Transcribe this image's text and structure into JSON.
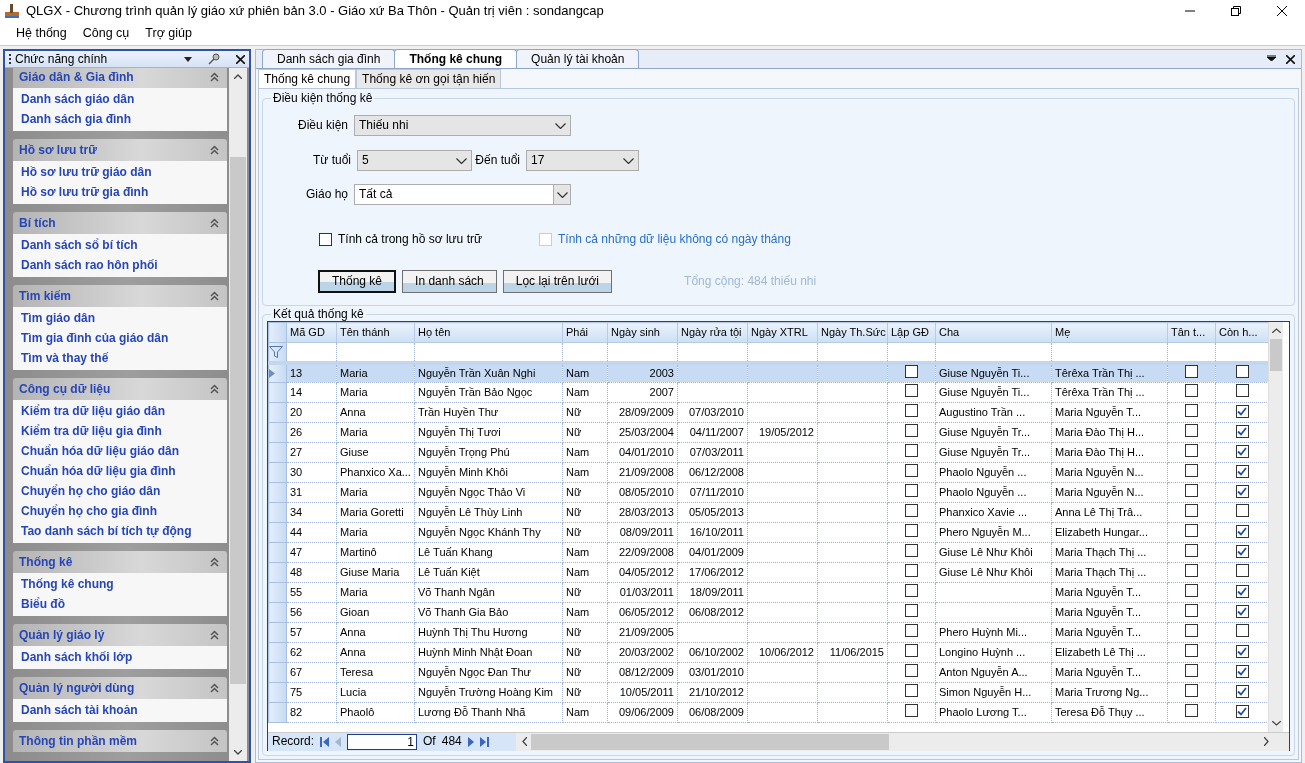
{
  "window": {
    "title": "QLGX - Chương trình quản lý giáo xứ phiên bản 3.0 - Giáo xứ Ba Thôn - Quản trị viên : sondangcap"
  },
  "menu": [
    "Hệ thống",
    "Công cụ",
    "Trợ giúp"
  ],
  "sidebar": {
    "title": "Chức năng chính",
    "groups": [
      {
        "title": "Giáo dân & Gia đình",
        "items": [
          "Danh sách giáo dân",
          "Danh sách gia đình"
        ]
      },
      {
        "title": "Hồ sơ lưu trữ",
        "items": [
          "Hồ sơ lưu trữ giáo dân",
          "Hồ sơ lưu trữ gia đình"
        ]
      },
      {
        "title": "Bí tích",
        "items": [
          "Danh sách sổ bí tích",
          "Danh sách rao hôn phối"
        ]
      },
      {
        "title": "Tìm kiếm",
        "items": [
          "Tìm giáo dân",
          "Tìm gia đình của giáo dân",
          "Tìm và thay thế"
        ]
      },
      {
        "title": "Công cụ dữ liệu",
        "items": [
          "Kiểm tra dữ liệu giáo dân",
          "Kiểm tra dữ liệu gia đình",
          "Chuẩn hóa dữ liệu giáo dân",
          "Chuẩn hóa dữ liệu gia đình",
          "Chuyển họ cho giáo dân",
          "Chuyển họ cho gia đình",
          "Tao danh sách bí tích tự động"
        ]
      },
      {
        "title": "Thống kê",
        "items": [
          "Thống kê chung",
          "Biểu đồ"
        ]
      },
      {
        "title": "Quản lý giáo lý",
        "items": [
          "Danh sách khối lớp"
        ]
      },
      {
        "title": "Quản lý người dùng",
        "items": [
          "Danh sách tài khoản"
        ]
      },
      {
        "title": "Thông tin phần mềm"
      }
    ]
  },
  "document_tabs": [
    {
      "label": "Danh sách gia đình",
      "selected": false
    },
    {
      "label": "Thống kê chung",
      "selected": true
    },
    {
      "label": "Quản lý tài khoản",
      "selected": false
    }
  ],
  "sub_tabs": [
    {
      "label": "Thống kê chung",
      "selected": true
    },
    {
      "label": "Thống kê ơn gọi tận hiến",
      "selected": false
    }
  ],
  "conditions": {
    "legend": "Điều kiện thống kê",
    "condition": {
      "label": "Điều kiện",
      "value": "Thiếu nhi"
    },
    "from_age": {
      "label": "Từ tuổi",
      "value": "5"
    },
    "to_age": {
      "label": "Đến tuổi",
      "value": "17"
    },
    "parish": {
      "label": "Giáo họ",
      "value": "Tất cả"
    },
    "checkboxes": [
      {
        "label": "Tính cả trong hồ sơ lưu trữ",
        "checked": false,
        "disabled": false
      },
      {
        "label": "Tính cả những dữ liệu không có ngày tháng",
        "checked": false,
        "disabled": true
      }
    ],
    "buttons": [
      {
        "label": "Thống kê",
        "default": true
      },
      {
        "label": "In danh sách",
        "default": false
      },
      {
        "label": "Lọc lại trên lưới",
        "default": false
      }
    ],
    "total": "Tổng cộng: 484 thiếu nhi"
  },
  "results": {
    "legend": "Kết quả thống kê",
    "columns": [
      "Mã GD",
      "Tên thánh",
      "Họ tên",
      "Phái",
      "Ngày sinh",
      "Ngày rửa tội",
      "Ngày XTRL",
      "Ngày Th.Sức",
      "Lập GĐ",
      "Cha",
      "Mẹ",
      "Tân t...",
      "Còn h..."
    ],
    "rows": [
      {
        "selected": true,
        "ma_gd": "13",
        "ten_thanh": "Maria",
        "ho_ten": "Nguyễn Trần Xuân Nghi",
        "phai": "Nam",
        "ngay_sinh": "2003",
        "lap_gd": false,
        "cha": "Giuse Nguyễn Ti...",
        "me": "Têrêxa Trần Thị ...",
        "tan_t": false,
        "con_h": false
      },
      {
        "selected": false,
        "ma_gd": "14",
        "ten_thanh": "Maria",
        "ho_ten": "Nguyễn Trần Bảo Ngọc",
        "phai": "Nam",
        "ngay_sinh": "2007",
        "lap_gd": false,
        "cha": "Giuse Nguyễn Ti...",
        "me": "Têrêxa Trần Thị ...",
        "tan_t": false,
        "con_h": false
      },
      {
        "selected": false,
        "ma_gd": "20",
        "ten_thanh": "Anna",
        "ho_ten": "Trần Huyền Thư",
        "phai": "Nữ",
        "ngay_sinh": "28/09/2009",
        "ngay_rua_toi": "07/03/2010",
        "lap_gd": false,
        "cha": "Augustino Trần ...",
        "me": "Maria Nguyễn T...",
        "tan_t": false,
        "con_h": true
      },
      {
        "selected": false,
        "ma_gd": "26",
        "ten_thanh": "Maria",
        "ho_ten": "Nguyễn Thị Tươi",
        "phai": "Nữ",
        "ngay_sinh": "25/03/2004",
        "ngay_rua_toi": "04/11/2007",
        "ngay_xtrl": "19/05/2012",
        "lap_gd": false,
        "cha": "Giuse Nguyễn Tr...",
        "me": "Maria Đào Thị H...",
        "tan_t": false,
        "con_h": true
      },
      {
        "selected": false,
        "ma_gd": "27",
        "ten_thanh": "Giuse",
        "ho_ten": "Nguyễn Trọng Phú",
        "phai": "Nam",
        "ngay_sinh": "04/01/2010",
        "ngay_rua_toi": "07/03/2011",
        "lap_gd": false,
        "cha": "Giuse Nguyễn Tr...",
        "me": "Maria Đào Thị H...",
        "tan_t": false,
        "con_h": true
      },
      {
        "selected": false,
        "ma_gd": "30",
        "ten_thanh": "Phanxico Xa...",
        "ho_ten": "Nguyễn Minh Khôi",
        "phai": "Nam",
        "ngay_sinh": "21/09/2008",
        "ngay_rua_toi": "06/12/2008",
        "lap_gd": false,
        "cha": "Phaolo Nguyễn ...",
        "me": "Maria Nguyễn N...",
        "tan_t": false,
        "con_h": true
      },
      {
        "selected": false,
        "ma_gd": "31",
        "ten_thanh": "Maria",
        "ho_ten": "Nguyễn Ngọc Thảo Vi",
        "phai": "Nữ",
        "ngay_sinh": "08/05/2010",
        "ngay_rua_toi": "07/11/2010",
        "lap_gd": false,
        "cha": "Phaolo Nguyễn ...",
        "me": "Maria Nguyễn N...",
        "tan_t": false,
        "con_h": true
      },
      {
        "selected": false,
        "ma_gd": "34",
        "ten_thanh": "Maria Goretti",
        "ho_ten": "Nguyễn Lê Thùy Linh",
        "phai": "Nữ",
        "ngay_sinh": "28/03/2013",
        "ngay_rua_toi": "05/05/2013",
        "lap_gd": false,
        "cha": "Phanxico Xavie ...",
        "me": "Anna Lê Thị Trâ...",
        "tan_t": false,
        "con_h": false
      },
      {
        "selected": false,
        "ma_gd": "44",
        "ten_thanh": "Maria",
        "ho_ten": "Nguyễn Ngọc Khánh Thy",
        "phai": "Nữ",
        "ngay_sinh": "08/09/2011",
        "ngay_rua_toi": "16/10/2011",
        "lap_gd": false,
        "cha": "Phero Nguyễn M...",
        "me": "Elizabeth Hungar...",
        "tan_t": false,
        "con_h": true
      },
      {
        "selected": false,
        "ma_gd": "47",
        "ten_thanh": "Martinô",
        "ho_ten": "Lê Tuấn Khang",
        "phai": "Nam",
        "ngay_sinh": "22/09/2008",
        "ngay_rua_toi": "04/01/2009",
        "lap_gd": false,
        "cha": "Giuse Lê Như Khôi",
        "me": "Maria Thạch Thị ...",
        "tan_t": false,
        "con_h": true
      },
      {
        "selected": false,
        "ma_gd": "48",
        "ten_thanh": "Giuse Maria",
        "ho_ten": "Lê Tuấn Kiệt",
        "phai": "Nam",
        "ngay_sinh": "04/05/2012",
        "ngay_rua_toi": "17/06/2012",
        "lap_gd": false,
        "cha": "Giuse Lê Như Khôi",
        "me": "Maria Thạch Thị ...",
        "tan_t": false,
        "con_h": false
      },
      {
        "selected": false,
        "ma_gd": "55",
        "ten_thanh": "Maria",
        "ho_ten": "Võ Thanh Ngân",
        "phai": "Nữ",
        "ngay_sinh": "01/03/2011",
        "ngay_rua_toi": "18/09/2011",
        "lap_gd": false,
        "me": "Maria Nguyễn T...",
        "tan_t": false,
        "con_h": true
      },
      {
        "selected": false,
        "ma_gd": "56",
        "ten_thanh": "Gioan",
        "ho_ten": "Võ Thanh Gia Bảo",
        "phai": "Nam",
        "ngay_sinh": "06/05/2012",
        "ngay_rua_toi": "06/08/2012",
        "lap_gd": false,
        "me": "Maria Nguyễn T...",
        "tan_t": false,
        "con_h": true
      },
      {
        "selected": false,
        "ma_gd": "57",
        "ten_thanh": "Anna",
        "ho_ten": "Huỳnh Thị Thu Hương",
        "phai": "Nữ",
        "ngay_sinh": "21/09/2005",
        "lap_gd": false,
        "cha": "Phero Huỳnh Mi...",
        "me": "Maria Nguyễn T...",
        "tan_t": false,
        "con_h": false
      },
      {
        "selected": false,
        "ma_gd": "62",
        "ten_thanh": "Anna",
        "ho_ten": "Huỳnh Minh Nhật Đoan",
        "phai": "Nữ",
        "ngay_sinh": "20/03/2002",
        "ngay_rua_toi": "06/10/2002",
        "ngay_xtrl": "10/06/2012",
        "ngay_th_suc": "11/06/2015",
        "lap_gd": false,
        "cha": "Longino Huỳnh ...",
        "me": "Elizabeth Lê Thị ...",
        "tan_t": false,
        "con_h": true
      },
      {
        "selected": false,
        "ma_gd": "67",
        "ten_thanh": "Teresa",
        "ho_ten": "Nguyễn Ngọc Đan Thư",
        "phai": "Nữ",
        "ngay_sinh": "08/12/2009",
        "ngay_rua_toi": "03/01/2010",
        "lap_gd": false,
        "cha": "Anton Nguyễn A...",
        "me": "Maria Nguyễn T...",
        "tan_t": false,
        "con_h": true
      },
      {
        "selected": false,
        "ma_gd": "75",
        "ten_thanh": "Lucia",
        "ho_ten": "Nguyễn Trường Hoàng Kim",
        "phai": "Nữ",
        "ngay_sinh": "10/05/2011",
        "ngay_rua_toi": "21/10/2012",
        "lap_gd": false,
        "cha": "Simon Nguyễn H...",
        "me": "Maria Trương Ng...",
        "tan_t": false,
        "con_h": true
      },
      {
        "selected": false,
        "ma_gd": "82",
        "ten_thanh": "Phaolô",
        "ho_ten": "Lương Đỗ Thanh Nhã",
        "phai": "Nam",
        "ngay_sinh": "09/06/2009",
        "ngay_rua_toi": "06/08/2009",
        "lap_gd": false,
        "cha": "Phaolo Lương T...",
        "me": "Teresa Đỗ Thụy ...",
        "tan_t": false,
        "con_h": true
      }
    ],
    "pager": {
      "label": "Record:",
      "current": "1",
      "of_label": "Of",
      "total": "484"
    }
  }
}
